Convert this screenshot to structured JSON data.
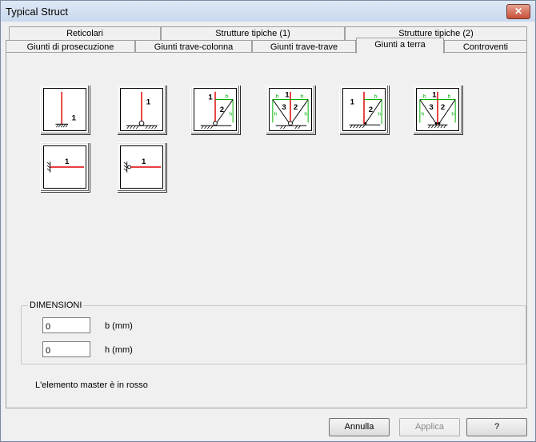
{
  "window": {
    "title": "Typical Struct"
  },
  "tabs_back": [
    "Reticolari",
    "Strutture tipiche (1)",
    "Strutture tipiche (2)"
  ],
  "tabs_front": [
    "Giunti di prosecuzione",
    "Giunti trave-colonna",
    "Giunti trave-trave",
    "Giunti a terra",
    "Controventi"
  ],
  "active_tab": "Giunti a terra",
  "icon_labels": {
    "icon1": [
      "1"
    ],
    "icon2": [
      "1"
    ],
    "icon3": [
      "1",
      "2",
      "b",
      "h"
    ],
    "icon4": [
      "1",
      "2",
      "3",
      "b",
      "b",
      "h",
      "h"
    ],
    "icon5": [
      "1",
      "2",
      "b",
      "h"
    ],
    "icon6": [
      "1",
      "2",
      "3",
      "b",
      "b",
      "h",
      "h"
    ],
    "icon7": [
      "1"
    ],
    "icon8": [
      "1"
    ]
  },
  "colors": {
    "master": "#e00000",
    "dimension": "#00b000"
  },
  "dimensions": {
    "label": "DIMENSIONI",
    "b_value": "0",
    "b_unit": "b (mm)",
    "h_value": "0",
    "h_unit": "h (mm)"
  },
  "note": "L'elemento master è in rosso",
  "buttons": {
    "cancel": "Annulla",
    "apply": "Applica",
    "help": "?"
  }
}
